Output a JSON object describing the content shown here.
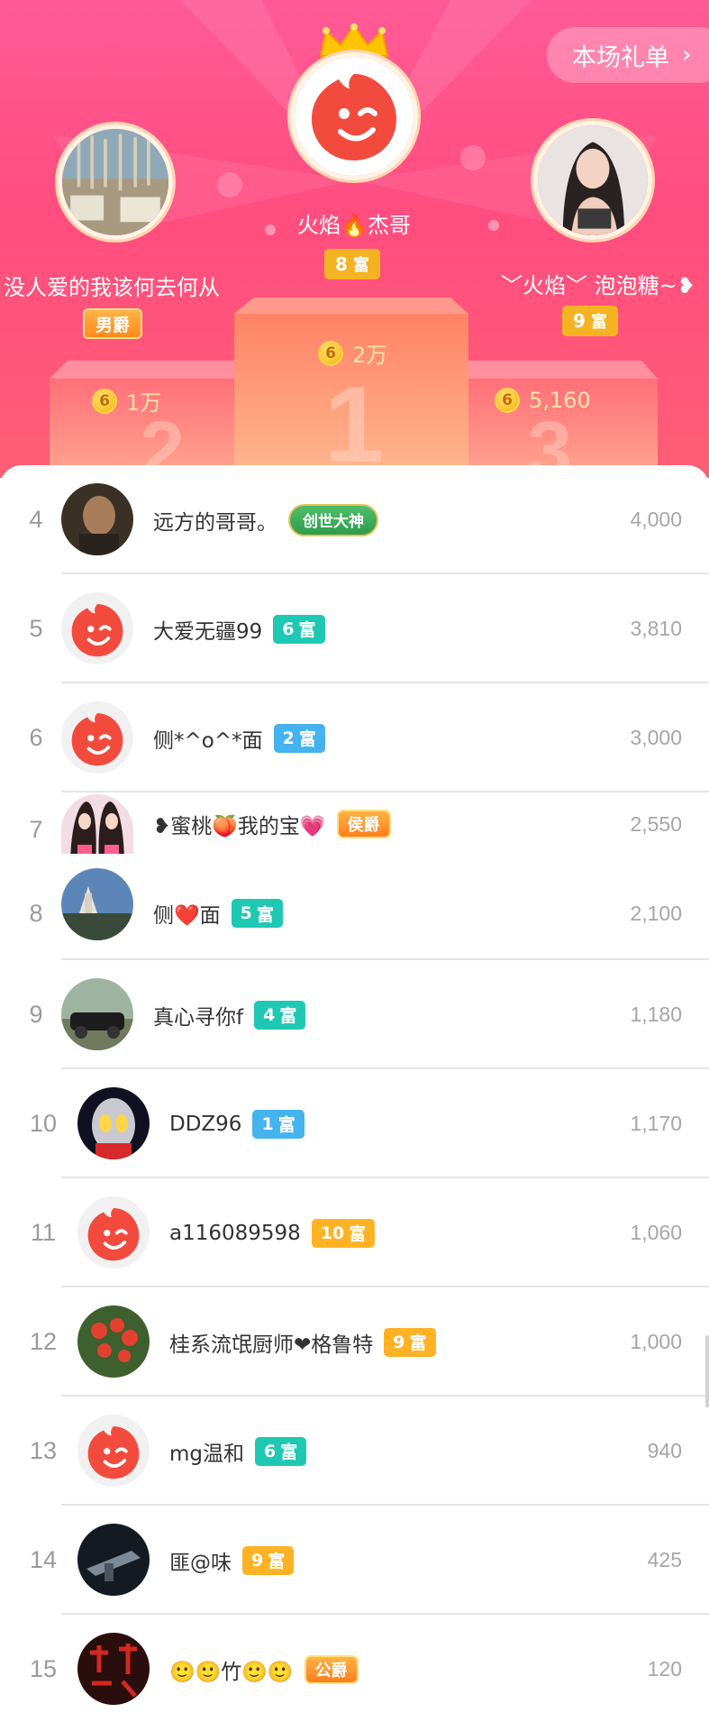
{
  "header": {
    "gift_list_button": "本场礼单",
    "podium": {
      "first": {
        "name": "火焰🔥杰哥",
        "rich_level": "8",
        "rich_label": "富",
        "amount": "2万"
      },
      "second": {
        "name": "没人爱的我该何去何从",
        "noble_label": "男爵",
        "amount": "1万"
      },
      "third": {
        "name": "﹀火焰﹀ 泡泡糖~❥",
        "rich_level": "9",
        "rich_label": "富",
        "amount": "5,160"
      }
    },
    "coin_symbol": "6"
  },
  "colors": {
    "header_pink": "#ff4d7f",
    "rich_gold": "#f5b324",
    "rich_teal": "#1ec8b3",
    "rich_blue": "#45b3ef",
    "rich_orange": "#ffb224",
    "noble_orange": "#ff8a1e",
    "avatar_red": "#f24b3e"
  },
  "list": [
    {
      "rank": "4",
      "name": "远方的哥哥。",
      "badge_type": "god",
      "badge_text": "创世大神",
      "value": "4,000"
    },
    {
      "rank": "5",
      "name": "大爱无疆99",
      "badge_type": "rich",
      "badge_level": "6",
      "badge_label": "富",
      "badge_color": "#1ec8b3",
      "value": "3,810"
    },
    {
      "rank": "6",
      "name": "侧*^o^*面",
      "badge_type": "rich",
      "badge_level": "2",
      "badge_label": "富",
      "badge_color": "#45b3ef",
      "value": "3,000"
    },
    {
      "rank": "7",
      "name": "❥蜜桃🍑我的宝💗",
      "badge_type": "noble",
      "badge_text": "侯爵",
      "value": "2,550"
    },
    {
      "rank": "8",
      "name": "侧❤️面",
      "badge_type": "rich",
      "badge_level": "5",
      "badge_label": "富",
      "badge_color": "#1ec8b3",
      "value": "2,100"
    },
    {
      "rank": "9",
      "name": "真心寻你f",
      "badge_type": "rich",
      "badge_level": "4",
      "badge_label": "富",
      "badge_color": "#1ec8b3",
      "value": "1,180"
    },
    {
      "rank": "10",
      "name": "DDZ96",
      "badge_type": "rich",
      "badge_level": "1",
      "badge_label": "富",
      "badge_color": "#45b3ef",
      "value": "1,170"
    },
    {
      "rank": "11",
      "name": "a116089598",
      "badge_type": "rich",
      "badge_level": "10",
      "badge_label": "富",
      "badge_color": "#ffb224",
      "value": "1,060"
    },
    {
      "rank": "12",
      "name": "桂系流氓厨师❤格鲁特",
      "badge_type": "rich",
      "badge_level": "9",
      "badge_label": "富",
      "badge_color": "#ffb224",
      "value": "1,000"
    },
    {
      "rank": "13",
      "name": "mg温和",
      "badge_type": "rich",
      "badge_level": "6",
      "badge_label": "富",
      "badge_color": "#1ec8b3",
      "value": "940"
    },
    {
      "rank": "14",
      "name": "匪@味",
      "badge_type": "rich",
      "badge_level": "9",
      "badge_label": "富",
      "badge_color": "#ffb224",
      "value": "425"
    },
    {
      "rank": "15",
      "name": "🙂🙂竹🙂🙂",
      "badge_type": "noble",
      "badge_text": "公爵",
      "value": "120"
    }
  ]
}
